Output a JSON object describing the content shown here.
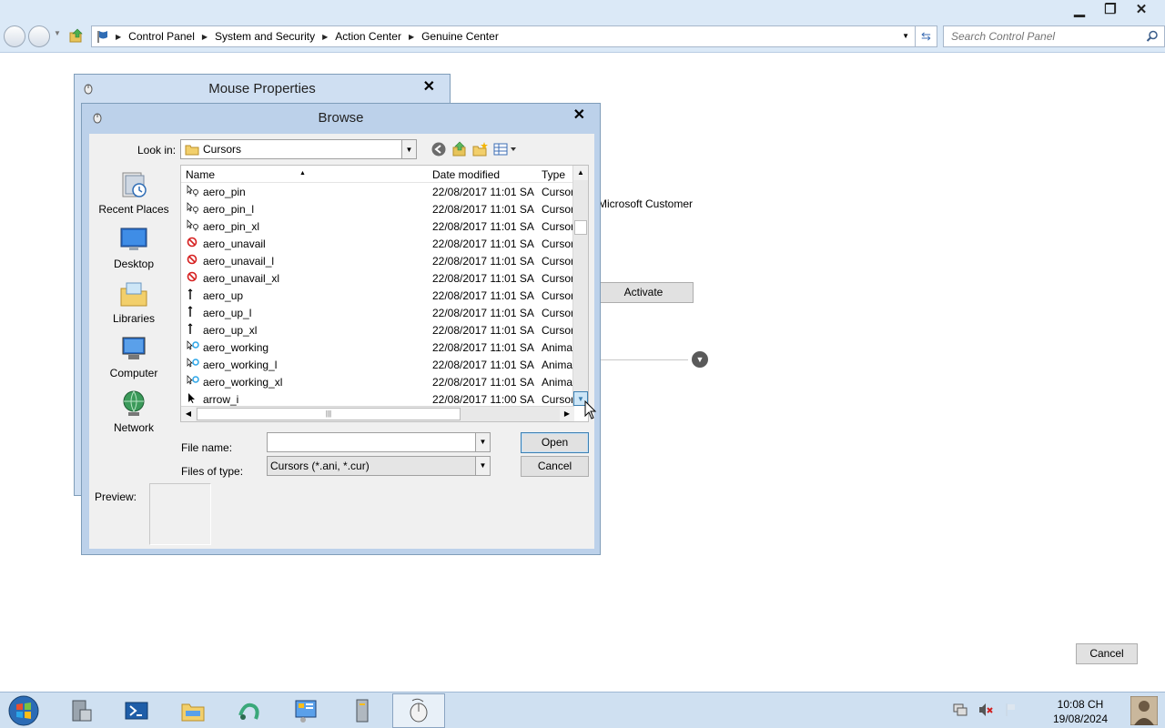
{
  "window": {
    "controls": {
      "minimize": "▁",
      "restore": "❐",
      "close": "✕"
    }
  },
  "address": {
    "crumbs": [
      "Control Panel",
      "System and Security",
      "Action Center",
      "Genuine Center"
    ]
  },
  "search": {
    "placeholder": "Search Control Panel"
  },
  "background": {
    "microsoft_customer": "Microsoft Customer",
    "activate": "Activate",
    "cancel": "Cancel"
  },
  "mouse_properties": {
    "title": "Mouse Properties"
  },
  "browse": {
    "title": "Browse",
    "look_in_label": "Look in:",
    "look_in_value": "Cursors",
    "places": [
      "Recent Places",
      "Desktop",
      "Libraries",
      "Computer",
      "Network"
    ],
    "columns": {
      "name": "Name",
      "date": "Date modified",
      "type": "Type"
    },
    "files": [
      {
        "name": "aero_pin",
        "date": "22/08/2017 11:01 SA",
        "type": "Cursor",
        "icon": "pin-cursor-icon"
      },
      {
        "name": "aero_pin_l",
        "date": "22/08/2017 11:01 SA",
        "type": "Cursor",
        "icon": "pin-cursor-icon"
      },
      {
        "name": "aero_pin_xl",
        "date": "22/08/2017 11:01 SA",
        "type": "Cursor",
        "icon": "pin-cursor-icon"
      },
      {
        "name": "aero_unavail",
        "date": "22/08/2017 11:01 SA",
        "type": "Cursor",
        "icon": "unavailable-cursor-icon"
      },
      {
        "name": "aero_unavail_l",
        "date": "22/08/2017 11:01 SA",
        "type": "Cursor",
        "icon": "unavailable-cursor-icon"
      },
      {
        "name": "aero_unavail_xl",
        "date": "22/08/2017 11:01 SA",
        "type": "Cursor",
        "icon": "unavailable-cursor-icon"
      },
      {
        "name": "aero_up",
        "date": "22/08/2017 11:01 SA",
        "type": "Cursor",
        "icon": "up-arrow-cursor-icon"
      },
      {
        "name": "aero_up_l",
        "date": "22/08/2017 11:01 SA",
        "type": "Cursor",
        "icon": "up-arrow-cursor-icon"
      },
      {
        "name": "aero_up_xl",
        "date": "22/08/2017 11:01 SA",
        "type": "Cursor",
        "icon": "up-arrow-cursor-icon"
      },
      {
        "name": "aero_working",
        "date": "22/08/2017 11:01 SA",
        "type": "Anima",
        "icon": "working-cursor-icon"
      },
      {
        "name": "aero_working_l",
        "date": "22/08/2017 11:01 SA",
        "type": "Anima",
        "icon": "working-cursor-icon"
      },
      {
        "name": "aero_working_xl",
        "date": "22/08/2017 11:01 SA",
        "type": "Anima",
        "icon": "working-cursor-icon"
      },
      {
        "name": "arrow_i",
        "date": "22/08/2017 11:00 SA",
        "type": "Cursor",
        "icon": "arrow-cursor-icon"
      }
    ],
    "file_name_label": "File name:",
    "file_name_value": "",
    "files_of_type_label": "Files of type:",
    "files_of_type_value": "Cursors (*.ani, *.cur)",
    "open": "Open",
    "cancel": "Cancel",
    "preview_label": "Preview:"
  },
  "taskbar": {
    "clock_time": "10:08 CH",
    "clock_date": "19/08/2024"
  },
  "colors": {
    "accent": "#3c6eb4",
    "titlebar": "#bcd1ea",
    "taskbar": "#cfe0f1"
  }
}
